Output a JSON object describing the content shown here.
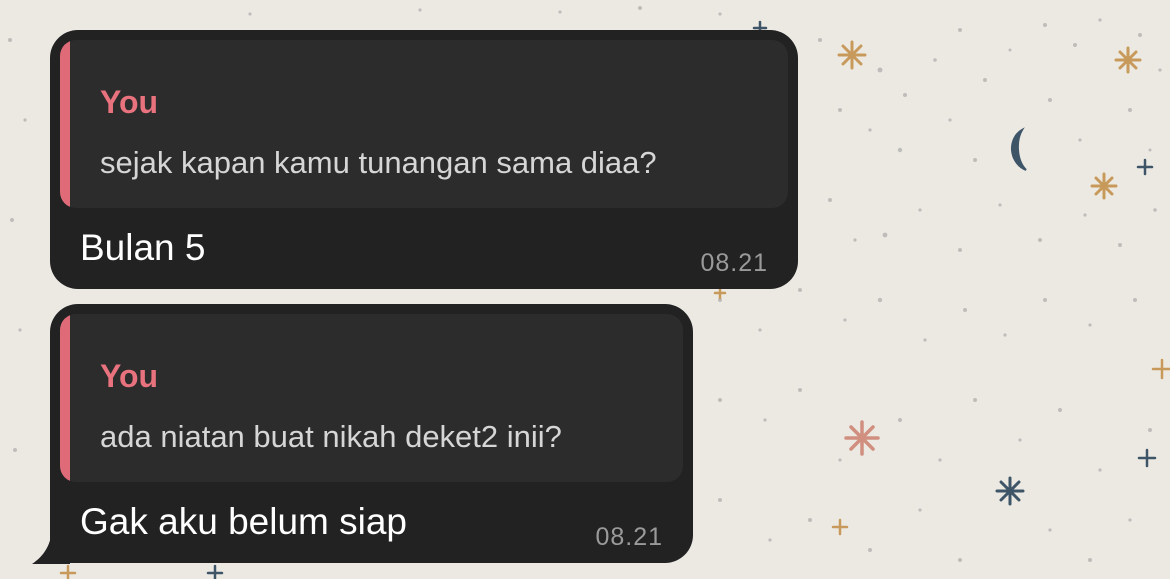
{
  "wallpaper": {
    "background_color": "#ece9e3",
    "decorations": [
      "star-icon",
      "moon-icon",
      "dots"
    ]
  },
  "colors": {
    "bubble": "#222223",
    "quote_background": "#2c2c2d",
    "quote_accent": "#e06b78",
    "quote_author": "#e8727d",
    "text": "#ffffff",
    "timestamp": "#9a9a9a"
  },
  "messages": [
    {
      "quoted": {
        "author": "You",
        "text": "sejak kapan kamu tunangan sama diaa?"
      },
      "text": "Bulan 5",
      "time": "08.21"
    },
    {
      "quoted": {
        "author": "You",
        "text": "ada niatan buat nikah deket2 inii?"
      },
      "text": "Gak aku belum siap",
      "time": "08.21"
    }
  ]
}
